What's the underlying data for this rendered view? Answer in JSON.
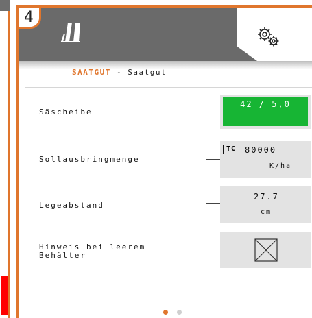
{
  "header": {
    "badge_number": "4",
    "seed_icon": "seed-drill-icon",
    "settings_icon": "gears-icon"
  },
  "subtitle": {
    "crop": "SAATGUT",
    "separator": "-",
    "name": "Saatgut"
  },
  "rows": {
    "seed_disc": {
      "label": "Säscheibe",
      "value": "42 / 5,0"
    },
    "target_rate": {
      "label": "Sollausbringmenge",
      "prefix": "TC",
      "value": "80000",
      "unit": "K/ha"
    },
    "spacing": {
      "label": "Legeabstand",
      "value": "27.7",
      "unit": "cm"
    },
    "empty_hint": {
      "label_line1": "Hinweis bei leerem",
      "label_line2": "Behälter"
    }
  },
  "pagination": {
    "pages": 2,
    "active": 1
  },
  "colors": {
    "accent": "#e0762d",
    "green": "#17b534",
    "header": "#6a6a6a"
  }
}
